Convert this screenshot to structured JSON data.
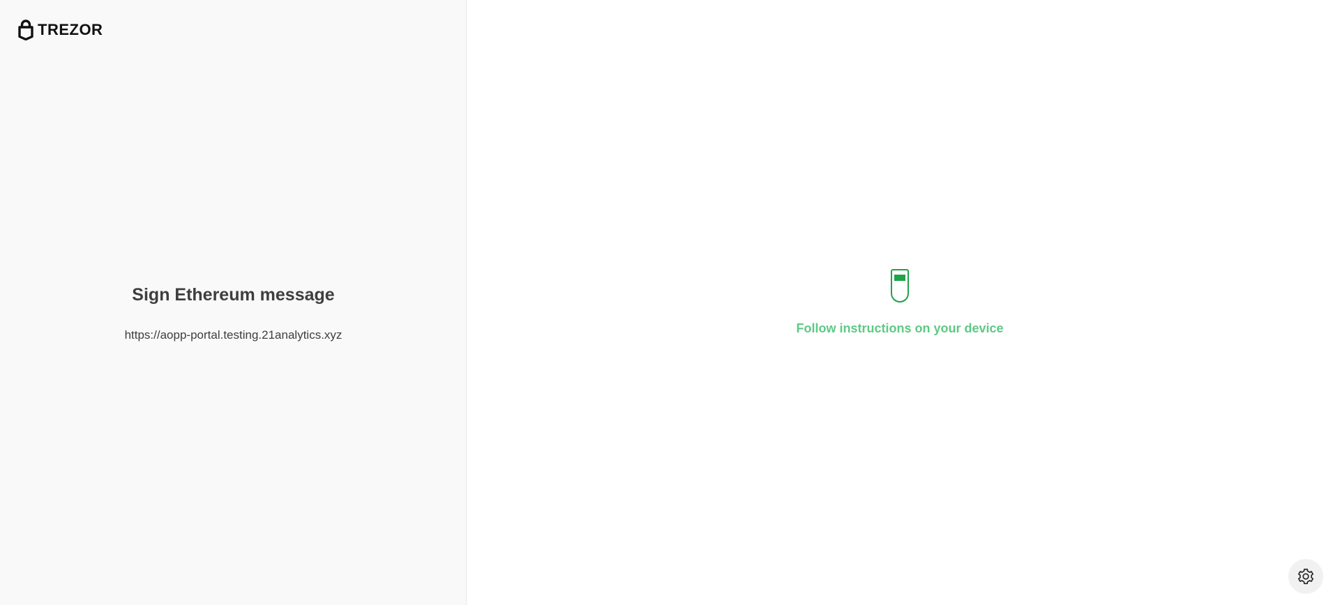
{
  "brand": {
    "logo_icon": "lock-icon",
    "name": "TREZOR"
  },
  "request": {
    "title": "Sign Ethereum message",
    "origin": "https://aopp-portal.testing.21analytics.xyz"
  },
  "device_prompt": {
    "icon": "trezor-device-icon",
    "text": "Follow instructions on your device"
  },
  "settings": {
    "icon": "gear-icon"
  },
  "colors": {
    "accent": "#1fa34a",
    "prompt_text": "#5ec985",
    "left_panel_bg": "#f9f9f9",
    "text_primary": "#3e3e3e"
  }
}
